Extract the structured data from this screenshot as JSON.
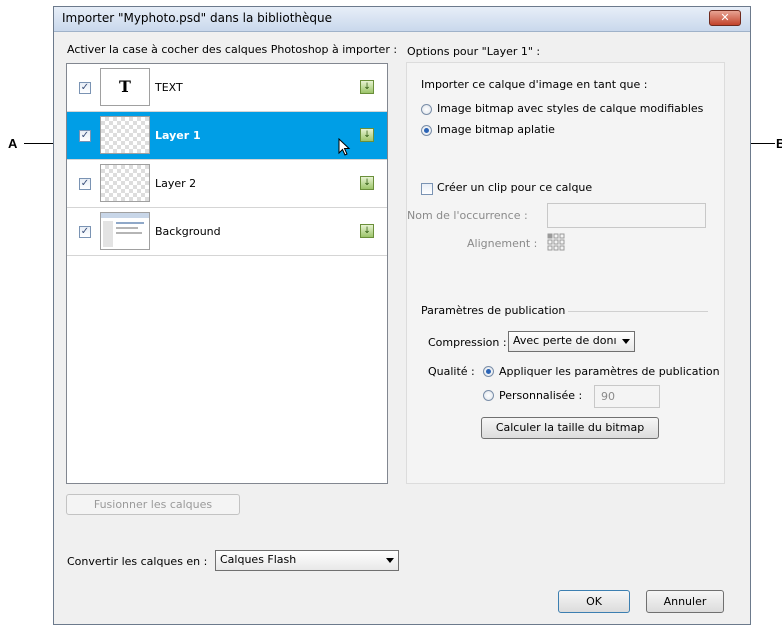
{
  "callouts": {
    "left": "A",
    "right": "B"
  },
  "window": {
    "title": "Importer \"Myphoto.psd\" dans la bibliothèque",
    "close_glyph": "✕"
  },
  "layers_section": {
    "label": "Activer la case à cocher des calques Photoshop à importer :",
    "layers": [
      {
        "name": "TEXT",
        "checked": "✓",
        "thumb_text": "T"
      },
      {
        "name": "Layer 1",
        "checked": "✓",
        "selected": true
      },
      {
        "name": "Layer 2",
        "checked": "✓"
      },
      {
        "name": "Background",
        "checked": "✓"
      }
    ],
    "merge_button": "Fusionner les calques"
  },
  "convert": {
    "label": "Convertir les calques en :",
    "value": "Calques Flash"
  },
  "options": {
    "title": "Options pour \"Layer 1\" :",
    "import_as_label": "Importer ce calque d'image en tant que :",
    "radio_editable": "Image bitmap avec styles de calque modifiables",
    "radio_flattened": "Image bitmap aplatie",
    "clip_checkbox": "Créer un clip pour ce calque",
    "instance_name_label": "Nom de l'occurrence :",
    "alignment_label": "Alignement :",
    "publish_section": "Paramètres de publication",
    "compression_label": "Compression :",
    "compression_value": "Avec perte de donı",
    "quality_label": "Qualité :",
    "quality_publish": "Appliquer les paramètres de publication",
    "quality_custom": "Personnalisée :",
    "quality_value": "90",
    "calc_button": "Calculer la taille du bitmap"
  },
  "footer": {
    "ok": "OK",
    "cancel": "Annuler"
  },
  "colors": {
    "selection": "#009ee6",
    "dialog_bg": "#f0f0f0"
  }
}
